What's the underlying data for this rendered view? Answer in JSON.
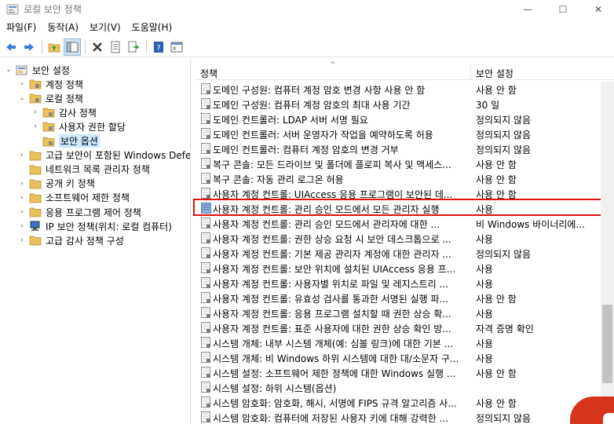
{
  "window": {
    "title": "로컬 보안 정책",
    "min_glyph": "—",
    "max_glyph": "☐",
    "close_glyph": "✕"
  },
  "menu": {
    "items": [
      "파일(F)",
      "동작(A)",
      "보기(V)",
      "도움말(H)"
    ]
  },
  "toolbar": {
    "buttons": [
      "back-arrow-icon",
      "forward-arrow-icon",
      "up-folder-icon",
      "show-hide-tree-icon",
      "delete-icon",
      "properties-icon",
      "export-list-icon",
      "help-icon",
      "console-icon"
    ]
  },
  "tree": {
    "items": [
      {
        "label": "보안 설정",
        "chev": "⌄",
        "indent": 0
      },
      {
        "label": "계정 정책",
        "chev": "›",
        "indent": 1
      },
      {
        "label": "로컬 정책",
        "chev": "⌄",
        "indent": 1
      },
      {
        "label": "감사 정책",
        "chev": "›",
        "indent": 2
      },
      {
        "label": "사용자 권한 할당",
        "chev": "›",
        "indent": 2
      },
      {
        "label": "보안 옵션",
        "chev": "",
        "indent": 2,
        "selected": true
      },
      {
        "label": "고급 보안이 포함된 Windows Defender",
        "chev": "›",
        "indent": 1
      },
      {
        "label": "네트워크 목록 관리자 정책",
        "chev": "",
        "indent": 1
      },
      {
        "label": "공개 키 정책",
        "chev": "›",
        "indent": 1
      },
      {
        "label": "소프트웨어 제한 정책",
        "chev": "›",
        "indent": 1
      },
      {
        "label": "응용 프로그램 제어 정책",
        "chev": "›",
        "indent": 1
      },
      {
        "label": "IP 보안 정책(위치: 로컬 컴퓨터)",
        "chev": "›",
        "indent": 1
      },
      {
        "label": "고급 감사 정책 구성",
        "chev": "›",
        "indent": 1
      }
    ]
  },
  "list": {
    "header_policy": "정책",
    "header_setting": "보안 설정",
    "rows": [
      {
        "name": "도메인 구성원: 컴퓨터 계정 암호 변경 사항 사용 안 함",
        "value": "사용 안 함"
      },
      {
        "name": "도메인 구성원: 컴퓨터 계정 암호의 최대 사용 기간",
        "value": "30 일"
      },
      {
        "name": "도메인 컨트롤러: LDAP 서버 서명 필요",
        "value": "정의되지 않음"
      },
      {
        "name": "도메인 컨트롤러: 서버 운영자가 작업을 예약하도록 허용",
        "value": "정의되지 않음"
      },
      {
        "name": "도메인 컨트롤러: 컴퓨터 계정 암호의 변경 거부",
        "value": "정의되지 않음"
      },
      {
        "name": "복구 콘솔: 모든 드라이브 및 폴더에 플로피 복사 및 액세스...",
        "value": "사용 안 함"
      },
      {
        "name": "복구 콘솔: 자동 관리 로그온 허용",
        "value": "사용 안 함"
      },
      {
        "name": "사용자 계정 컨트롤: UIAccess 응용 프로그램이 보안된 데...",
        "value": "사용 안 함"
      },
      {
        "name": "사용자 계정 컨트롤: 관리 승인 모드에서 모든 관리자 실행",
        "value": "사용"
      },
      {
        "name": "사용자 계정 컨트롤: 관리 승인 모드에서 관리자에 대한 ...",
        "value": "비 Windows 바이너리에..."
      },
      {
        "name": "사용자 계정 컨트롤: 권한 상승 요청 시 보안 데스크톱으로 ...",
        "value": "사용"
      },
      {
        "name": "사용자 계정 컨트롤: 기본 제공 관리자 계정에 대한 관리자 ...",
        "value": "정의되지 않음"
      },
      {
        "name": "사용자 계정 컨트롤: 보안 위치에 설치된 UIAccess 응용 프...",
        "value": "사용"
      },
      {
        "name": "사용자 계정 컨트롤: 사용자별 위치로 파일 및 레지스트리 ...",
        "value": "사용"
      },
      {
        "name": "사용자 계정 컨트롤: 유효성 검사를 통과한 서명된 실행 파...",
        "value": "사용 안 함"
      },
      {
        "name": "사용자 계정 컨트롤: 응용 프로그램 설치할 때 권한 상승 확...",
        "value": "사용"
      },
      {
        "name": "사용자 계정 컨트롤: 표준 사용자에 대한 권한 상승 확인 방...",
        "value": "자격 증명 확인"
      },
      {
        "name": "시스템 개체: 내부 시스템 개체(예: 심볼 링크)에 대한 기본 ...",
        "value": "사용"
      },
      {
        "name": "시스템 개체: 비 Windows 하위 시스템에 대한 대/소문자 구...",
        "value": "사용"
      },
      {
        "name": "시스템 설정: 소프트웨어 제한 정책에 대한 Windows 실행 ...",
        "value": "사용 안 함"
      },
      {
        "name": "시스템 설정: 하위 시스템(옵션)",
        "value": ""
      },
      {
        "name": "시스템 암호화: 암호화, 해시, 서명에 FIPS 규격 알고리즘 사...",
        "value": "사용 안 함"
      },
      {
        "name": "시스템 암호화: 컴퓨터에 저장된 사용자 키에 대해 강력한 ...",
        "value": "정의되지 않음"
      }
    ]
  },
  "colors": {
    "selection": "#cce8ff",
    "highlight_box": "#e01010",
    "folder": "#e8c35a"
  }
}
